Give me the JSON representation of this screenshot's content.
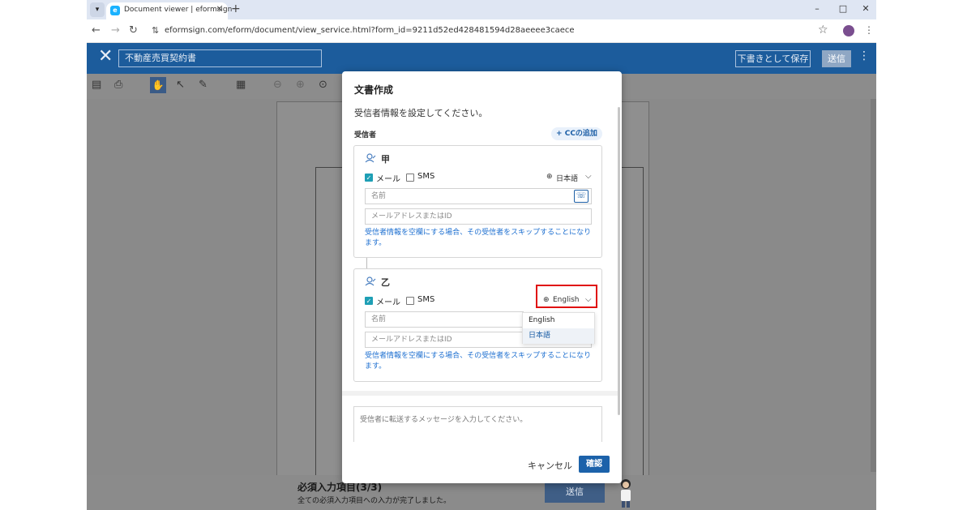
{
  "browser": {
    "tab_title": "Document viewer | eformsign",
    "favicon_letter": "e",
    "url": "eformsign.com/eform/document/view_service.html?form_id=9211d52ed428481594d28aeeee3caece",
    "icons": {
      "menu": "▾",
      "new_tab": "+",
      "minimize": "–",
      "maximize": "□",
      "close": "✕",
      "back": "←",
      "forward": "→",
      "reload": "↻",
      "site_info": "⇅",
      "bookmark": "☆",
      "kebab": "⋮"
    }
  },
  "app": {
    "close_glyph": "✕",
    "doc_title": "不動産売買契約書",
    "save_draft": "下書きとして保存",
    "send": "送信",
    "kebab": "⋮"
  },
  "bottom": {
    "req_title": "必須入力項目(3/3)",
    "req_sub": "全ての必須入力項目への入力が完了しました。",
    "send": "送信"
  },
  "modal": {
    "title": "文書作成",
    "desc": "受信者情報を設定してください。",
    "recipients_label": "受信者",
    "cc_button": "+ CCの追加",
    "recipients": [
      {
        "party": "甲",
        "email_label": "メール",
        "sms_label": "SMS",
        "language": "日本語",
        "name_placeholder": "名前",
        "email_placeholder": "メールアドレスまたはID",
        "note": "受信者情報を空欄にする場合、その受信者をスキップすることになります。"
      },
      {
        "party": "乙",
        "email_label": "メール",
        "sms_label": "SMS",
        "language": "English",
        "name_placeholder": "名前",
        "email_placeholder": "メールアドレスまたはID",
        "note": "受信者情報を空欄にする場合、その受信者をスキップすることになります。",
        "language_options": [
          "English",
          "日本語"
        ]
      }
    ],
    "message_placeholder": "受信者に転送するメッセージを入力してください。",
    "cancel": "キャンセル",
    "confirm": "確認"
  },
  "colors": {
    "header": "#1c5c9c",
    "primary": "#1c62aa",
    "link": "#1d6fd0",
    "checkbox": "#1e9fb5",
    "highlight": "#e01010"
  }
}
